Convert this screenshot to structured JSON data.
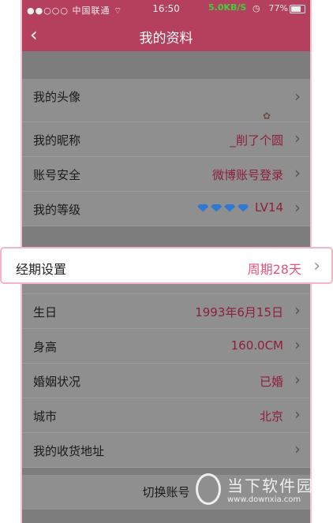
{
  "status_bar": {
    "signal": "●●○○○",
    "carrier": "中国联通",
    "time": "16:50",
    "network": "5.0KB/S",
    "battery": "77%"
  },
  "nav": {
    "back_icon": "chevron-left-icon",
    "title": "我的资料"
  },
  "profile": {
    "avatar_label": "我的头像",
    "nickname_label": "我的昵称",
    "nickname_value": "_削了个圆",
    "security_label": "账号安全",
    "security_value": "微博账号登录",
    "level_label": "我的等级",
    "level_value": "LV14",
    "level_gem_count": 4
  },
  "cycle": {
    "label": "经期设置",
    "value": "周期28天"
  },
  "details": {
    "birthday_label": "生日",
    "birthday_value": "1993年6月15日",
    "height_label": "身高",
    "height_value": "160.0CM",
    "marital_label": "婚姻状况",
    "marital_value": "已婚",
    "city_label": "城市",
    "city_value": "北京",
    "address_label": "我的收货地址"
  },
  "switch_account": "切换账号",
  "watermark": {
    "title": "当下软件园",
    "url": "www.downxia.com"
  },
  "colors": {
    "nav_bg": "#b5405e",
    "accent_value": "#e0557a",
    "gem": "#2f7ad0"
  }
}
